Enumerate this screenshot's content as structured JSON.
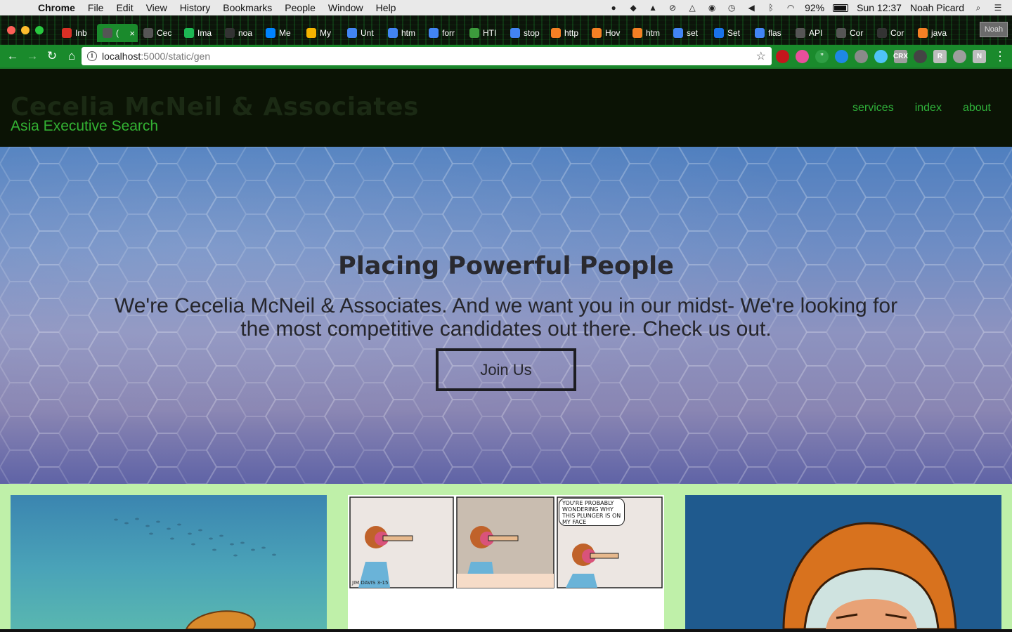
{
  "menubar": {
    "app_name": "Chrome",
    "items": [
      "File",
      "Edit",
      "View",
      "History",
      "Bookmarks",
      "People",
      "Window",
      "Help"
    ],
    "battery": "92%",
    "battery_level": 0.92,
    "clock": "Sun 12:37",
    "user": "Noah Picard"
  },
  "tabs": [
    {
      "label": "Inb",
      "icon": "gmail-icon",
      "color": "#d93025"
    },
    {
      "label": "(",
      "icon": "document-icon",
      "color": "#555555",
      "active": true
    },
    {
      "label": "Cec",
      "icon": "document-icon",
      "color": "#555555"
    },
    {
      "label": "Ima",
      "icon": "spotify-icon",
      "color": "#1db954"
    },
    {
      "label": "noa",
      "icon": "blank-icon",
      "color": "#333333"
    },
    {
      "label": "Me",
      "icon": "messenger-icon",
      "color": "#0084ff"
    },
    {
      "label": "My",
      "icon": "google-drive-icon",
      "color": "#f4b400"
    },
    {
      "label": "Unt",
      "icon": "google-docs-icon",
      "color": "#4285f4"
    },
    {
      "label": "htm",
      "icon": "google-icon",
      "color": "#4285f4"
    },
    {
      "label": "forr",
      "icon": "google-icon",
      "color": "#4285f4"
    },
    {
      "label": "HTI",
      "icon": "chart-icon",
      "color": "#3c9b3c"
    },
    {
      "label": "stop",
      "icon": "google-icon",
      "color": "#4285f4"
    },
    {
      "label": "http",
      "icon": "stackoverflow-icon",
      "color": "#f48024"
    },
    {
      "label": "Hov",
      "icon": "stackoverflow-icon",
      "color": "#f48024"
    },
    {
      "label": "htm",
      "icon": "stackoverflow-icon",
      "color": "#f48024"
    },
    {
      "label": "set",
      "icon": "google-icon",
      "color": "#4285f4"
    },
    {
      "label": "Set",
      "icon": "app-icon",
      "color": "#1a73e8"
    },
    {
      "label": "flas",
      "icon": "google-icon",
      "color": "#4285f4"
    },
    {
      "label": "API",
      "icon": "document-icon",
      "color": "#555555"
    },
    {
      "label": "Cor",
      "icon": "document-icon",
      "color": "#555555"
    },
    {
      "label": "Cor",
      "icon": "blank-icon",
      "color": "#333333"
    },
    {
      "label": "java",
      "icon": "stackoverflow-icon",
      "color": "#f48024"
    }
  ],
  "profile_button": "Noah",
  "omnibox": {
    "host": "localhost",
    "path": ":5000/static/gen"
  },
  "extensions": [
    {
      "icon": "ublock-icon",
      "color": "#c4161c",
      "glyph": ""
    },
    {
      "icon": "color-picker-icon",
      "color": "#e84f9b",
      "glyph": ""
    },
    {
      "icon": "quote-icon",
      "color": "#2f9e44",
      "glyph": "”"
    },
    {
      "icon": "globe-icon",
      "color": "#1e88e5",
      "glyph": ""
    },
    {
      "icon": "pocket-icon",
      "color": "#8a8a8a",
      "glyph": ""
    },
    {
      "icon": "heart-shield-icon",
      "color": "#4fc3f7",
      "glyph": ""
    },
    {
      "icon": "crx-icon",
      "color": "#9e9e9e",
      "glyph": "CRX"
    },
    {
      "icon": "terminal-icon",
      "color": "#444444",
      "glyph": ""
    },
    {
      "icon": "r-extension-icon",
      "color": "#bdbdbd",
      "glyph": "R"
    },
    {
      "icon": "drive-extension-icon",
      "color": "#9e9e9e",
      "glyph": ""
    },
    {
      "icon": "n-extension-icon",
      "color": "#bdbdbd",
      "glyph": "N"
    }
  ],
  "site": {
    "brand": "Cecelia McNeil & Associates",
    "tagline": "Asia Executive Search",
    "nav": [
      "services",
      "index",
      "about"
    ],
    "hero_title": "Placing Powerful People",
    "hero_body": "We're Cecelia McNeil & Associates. And we want you in our midst- We're looking for the most competitive candidates out there. Check us out.",
    "join_button": "Join Us",
    "comic_bubble": "YOU'RE PROBABLY WONDERING WHY THIS PLUNGER IS ON MY FACE",
    "comic_signature": "JIM DAVIS 3-15"
  },
  "colors": {
    "page_background": "#bff0a9",
    "header_background": "#0b1305",
    "nav_link": "#2fb03a",
    "toolbar": "#1a8a2c"
  }
}
